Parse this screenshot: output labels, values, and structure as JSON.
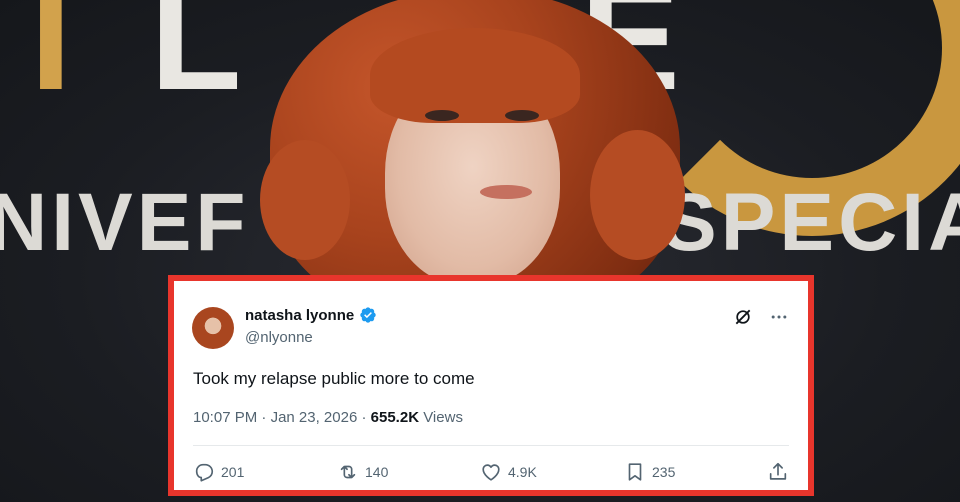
{
  "tweet": {
    "display_name": "natasha lyonne",
    "handle": "@nlyonne",
    "text": "Took my relapse public more to come",
    "time": "10:07 PM",
    "date": "Jan 23, 2026",
    "separator": "·",
    "views_count": "655.2K",
    "views_label": "Views",
    "replies": "201",
    "retweets": "140",
    "likes": "4.9K",
    "bookmarks": "235"
  },
  "icons": [
    "verified-badge-icon",
    "grok-icon",
    "more-icon",
    "reply-icon",
    "retweet-icon",
    "like-icon",
    "bookmark-icon",
    "share-icon"
  ],
  "colors": {
    "frame": "#e8352c",
    "verified": "#1d9bf0",
    "muted": "#536471",
    "text": "#0f1419"
  }
}
